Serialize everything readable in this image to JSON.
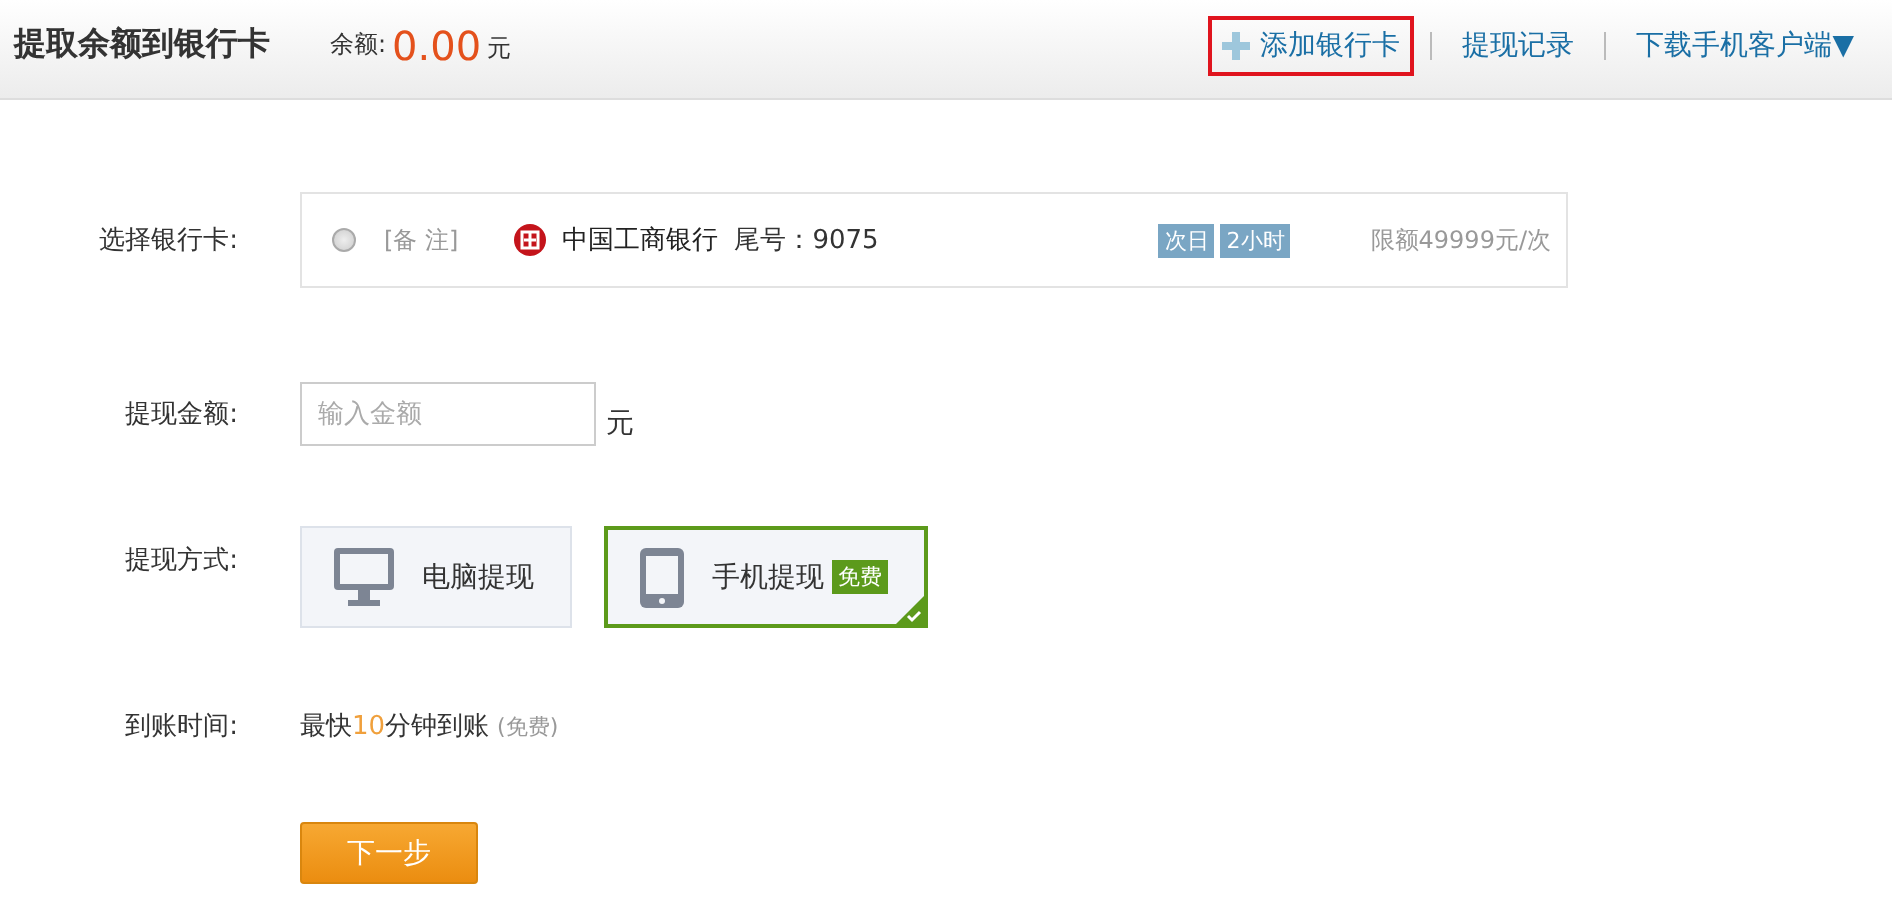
{
  "header": {
    "title": "提取余额到银行卡",
    "balance_label": "余额:",
    "balance": "0.00",
    "balance_unit": "元",
    "links": [
      {
        "label": "添加银行卡",
        "kind": "add",
        "highlighted": true
      },
      {
        "label": "提现记录",
        "kind": "plain",
        "highlighted": false
      },
      {
        "label": "下载手机客户端▼",
        "kind": "plain",
        "highlighted": false
      }
    ]
  },
  "bank_card": {
    "label": "选择银行卡:",
    "selected": false,
    "note": "[备 注]",
    "bank": "中国工商银行",
    "tail": "尾号：9075",
    "tags": [
      "次日",
      "2小时"
    ],
    "limit": "限额49999元/次"
  },
  "amount": {
    "label": "提现金额:",
    "placeholder": "输入金额",
    "unit": "元"
  },
  "method": {
    "label": "提现方式:",
    "options": [
      {
        "label": "电脑提现",
        "kind": "computer",
        "selected": false
      },
      {
        "label": "手机提现",
        "kind": "phone",
        "selected": true,
        "badge": "免费"
      }
    ]
  },
  "arrival": {
    "label": "到账时间:",
    "prefix": "最快",
    "highlight": "10",
    "suffix": "分钟到账",
    "note": "(免费)"
  },
  "next_button": "下一步"
}
